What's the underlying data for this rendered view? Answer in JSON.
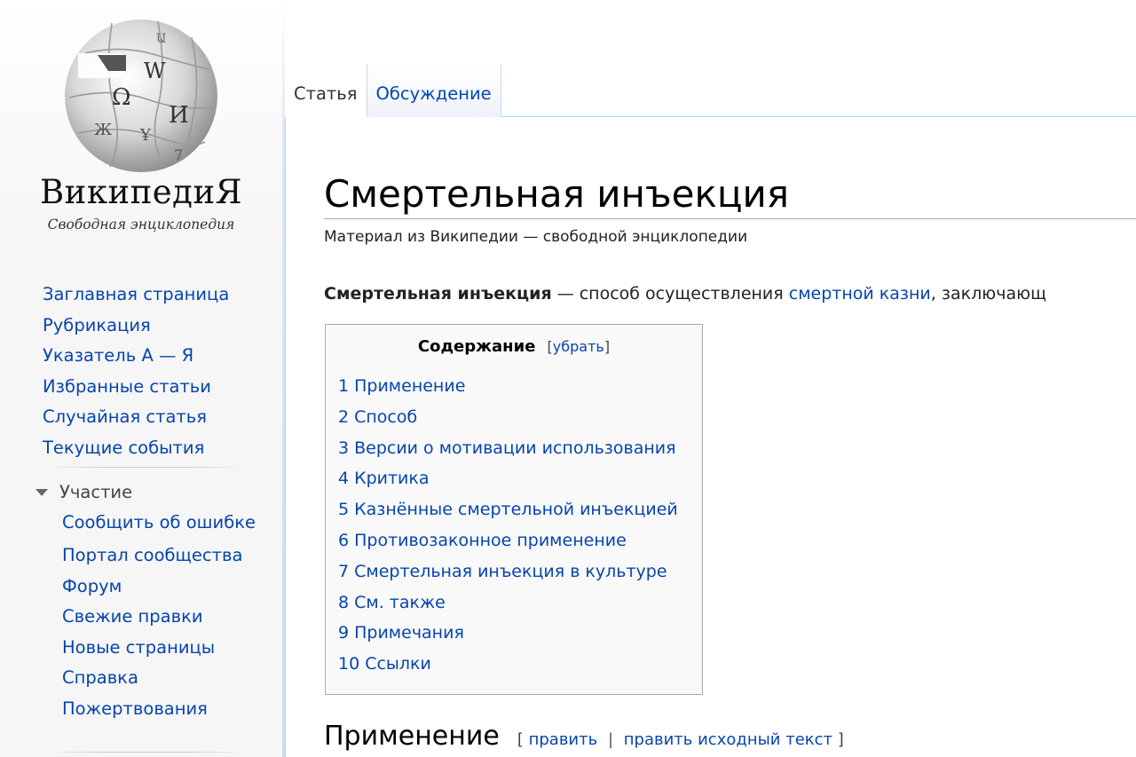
{
  "logo": {
    "wordmark": "ВикипедиЯ",
    "tagline": "Свободная энциклопедия"
  },
  "sidebar": {
    "nav": [
      {
        "label": "Заглавная страница"
      },
      {
        "label": "Рубрикация"
      },
      {
        "label": "Указатель А — Я"
      },
      {
        "label": "Избранные статьи"
      },
      {
        "label": "Случайная статья"
      },
      {
        "label": "Текущие события"
      }
    ],
    "portal": {
      "title": "Участие",
      "items": [
        {
          "label": "Сообщить об ошибке"
        },
        {
          "label": "Портал сообщества"
        },
        {
          "label": "Форум"
        },
        {
          "label": "Свежие правки"
        },
        {
          "label": "Новые страницы"
        },
        {
          "label": "Справка"
        },
        {
          "label": "Пожертвования"
        }
      ]
    }
  },
  "tabs": [
    {
      "label": "Статья",
      "selected": true
    },
    {
      "label": "Обсуждение",
      "selected": false
    }
  ],
  "article": {
    "title": "Смертельная инъекция",
    "site_sub": "Материал из Википедии — свободной энциклопедии",
    "lead": {
      "bold": "Смертельная инъекция",
      "text": " — способ осуществления ",
      "link": "смертной казни",
      "rest": ", заключающ"
    },
    "toc": {
      "title": "Содержание",
      "toggle_open": "[",
      "toggle_label": "убрать",
      "toggle_close": "]",
      "items": [
        {
          "num": "1",
          "label": "Применение"
        },
        {
          "num": "2",
          "label": "Способ"
        },
        {
          "num": "3",
          "label": "Версии о мотивации использования"
        },
        {
          "num": "4",
          "label": "Критика"
        },
        {
          "num": "5",
          "label": "Казнённые смертельной инъекцией"
        },
        {
          "num": "6",
          "label": "Противозаконное применение"
        },
        {
          "num": "7",
          "label": "Смертельная инъекция в культуре"
        },
        {
          "num": "8",
          "label": "См. также"
        },
        {
          "num": "9",
          "label": "Примечания"
        },
        {
          "num": "10",
          "label": "Ссылки"
        }
      ]
    },
    "section": {
      "title": "Применение",
      "edit_open": "[",
      "edit_label": "править",
      "edit_sep": "|",
      "edit_source_label": "править исходный текст",
      "edit_close": "]"
    }
  },
  "colors": {
    "link": "#0645ad",
    "sidebar_bg": "#f6f6f6",
    "border_blue": "#a7d7f9"
  }
}
